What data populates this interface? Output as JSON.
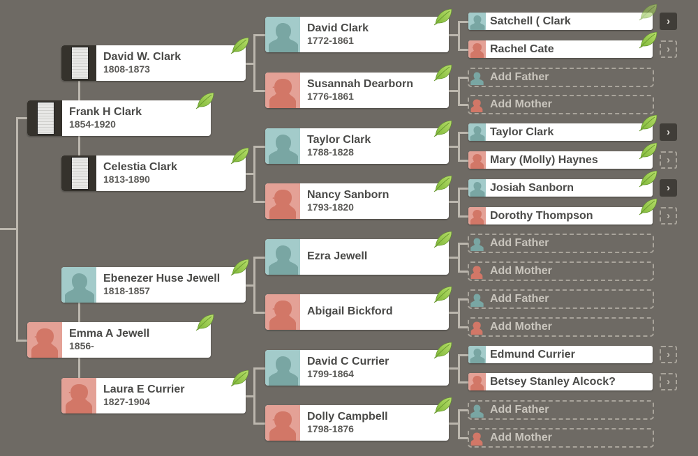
{
  "app": "Family Tree Pedigree View",
  "colors": {
    "background": "#6e6a64",
    "connector": "#bcb7ae",
    "male_photo_bg": "#a3cbca",
    "male_silhouette": "#79a6a3",
    "female_photo_bg": "#e4a196",
    "female_silhouette": "#d27767",
    "leaf": "#8cc43d",
    "add_text": "#c9c5bd"
  },
  "generation1": [
    {
      "name": "Frank H Clark",
      "dates": "1854-1920",
      "photo": "document",
      "hint": true
    },
    {
      "name": "Emma A Jewell",
      "dates": "1856-",
      "photo": "female",
      "hint": true
    }
  ],
  "generation2": [
    {
      "name": "David W. Clark",
      "dates": "1808-1873",
      "photo": "document",
      "hint": true
    },
    {
      "name": "Celestia Clark",
      "dates": "1813-1890",
      "photo": "document",
      "hint": true
    },
    {
      "name": "Ebenezer Huse Jewell",
      "dates": "1818-1857",
      "photo": "male",
      "hint": true
    },
    {
      "name": "Laura E Currier",
      "dates": "1827-1904",
      "photo": "female",
      "hint": true
    }
  ],
  "generation3": [
    {
      "name": "David Clark",
      "dates": "1772-1861",
      "photo": "male",
      "hint": true
    },
    {
      "name": "Susannah Dearborn",
      "dates": "1776-1861",
      "photo": "female",
      "hint": true
    },
    {
      "name": "Taylor Clark",
      "dates": "1788-1828",
      "photo": "male",
      "hint": true
    },
    {
      "name": "Nancy Sanborn",
      "dates": "1793-1820",
      "photo": "female",
      "hint": true
    },
    {
      "name": "Ezra Jewell",
      "dates": "",
      "photo": "male",
      "hint": true
    },
    {
      "name": "Abigail Bickford",
      "dates": "",
      "photo": "female",
      "hint": true
    },
    {
      "name": "David C Currier",
      "dates": "1799-1864",
      "photo": "male",
      "hint": true
    },
    {
      "name": "Dolly Campbell",
      "dates": "1798-1876",
      "photo": "female",
      "hint": true
    }
  ],
  "generation4": [
    {
      "name": "Satchell ( Clark",
      "type": "male",
      "hint": true,
      "hint_faded": true,
      "expand": "solid"
    },
    {
      "name": "Rachel Cate",
      "type": "female",
      "hint": true,
      "expand": "dashed"
    },
    {
      "name": "Add Father",
      "type": "add-father"
    },
    {
      "name": "Add Mother",
      "type": "add-mother"
    },
    {
      "name": "Taylor Clark",
      "type": "male",
      "hint": true,
      "expand": "solid"
    },
    {
      "name": "Mary (Molly) Haynes",
      "type": "female",
      "hint": true,
      "expand": "dashed"
    },
    {
      "name": "Josiah Sanborn",
      "type": "male",
      "hint": true,
      "expand": "solid"
    },
    {
      "name": "Dorothy Thompson",
      "type": "female",
      "hint": true,
      "expand": "dashed"
    },
    {
      "name": "Add Father",
      "type": "add-father"
    },
    {
      "name": "Add Mother",
      "type": "add-mother"
    },
    {
      "name": "Add Father",
      "type": "add-father"
    },
    {
      "name": "Add Mother",
      "type": "add-mother"
    },
    {
      "name": "Edmund Currier",
      "type": "male",
      "hint": false,
      "expand": "dashed"
    },
    {
      "name": "Betsey Stanley Alcock?",
      "type": "female",
      "hint": false,
      "expand": "dashed"
    },
    {
      "name": "Add Father",
      "type": "add-father"
    },
    {
      "name": "Add Mother",
      "type": "add-mother"
    }
  ],
  "icons": {
    "expand": "chevron-right-icon",
    "hint": "leaf-icon",
    "male": "male-silhouette-icon",
    "female": "female-silhouette-icon",
    "document": "document-photo-icon"
  },
  "chevron_glyph": "›"
}
